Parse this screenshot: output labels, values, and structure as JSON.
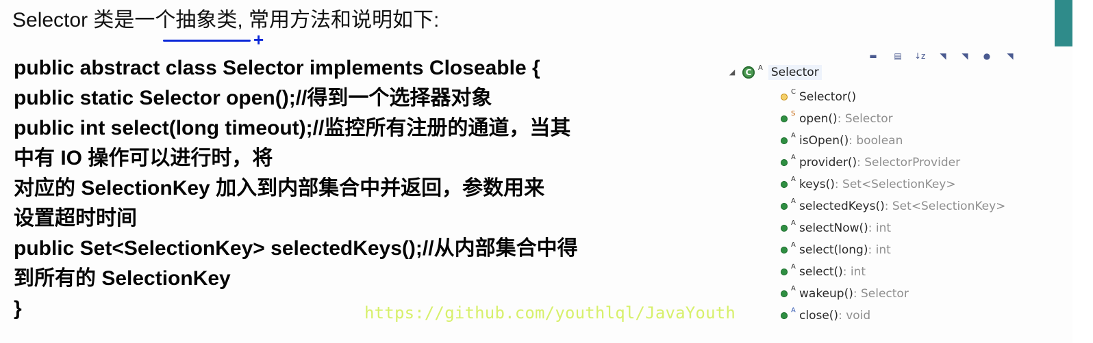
{
  "intro": {
    "text": "Selector 类是一个抽象类, 常用方法和说明如下:"
  },
  "code_lines": [
    "public abstract class Selector implements Closeable {",
    "public static Selector open();//得到一个选择器对象",
    "public int select(long timeout);//监控所有注册的通道，当其",
    "中有 IO 操作可以进行时，将",
    "对应的 SelectionKey 加入到内部集合中并返回，参数用来",
    "设置超时时间",
    "public Set<SelectionKey> selectedKeys();//从内部集合中得",
    "到所有的 SelectionKey",
    "}"
  ],
  "watermark": {
    "text": "https://github.com/youthlql/JavaYouth"
  },
  "outline": {
    "root": {
      "label": "Selector",
      "class_badge": "C",
      "modifier": "A",
      "expander": "◢"
    },
    "toolbar_icons": [
      "fields-icon",
      "static-icon",
      "sort-icon",
      "hide-fields-icon",
      "hide-static-icon",
      "hide-nonpublic-icon",
      "collapse-icon"
    ],
    "members": [
      {
        "kind": "ctor",
        "modifier": "C",
        "name": "Selector()",
        "type": ""
      },
      {
        "kind": "method",
        "modifier": "S",
        "name": "open()",
        "type": " : Selector"
      },
      {
        "kind": "method",
        "modifier": "A",
        "name": "isOpen()",
        "type": " : boolean"
      },
      {
        "kind": "method",
        "modifier": "A",
        "name": "provider()",
        "type": " : SelectorProvider"
      },
      {
        "kind": "method",
        "modifier": "A",
        "name": "keys()",
        "type": " : Set<SelectionKey>"
      },
      {
        "kind": "method",
        "modifier": "A",
        "name": "selectedKeys()",
        "type": " : Set<SelectionKey>"
      },
      {
        "kind": "method",
        "modifier": "A",
        "name": "selectNow()",
        "type": " : int"
      },
      {
        "kind": "method",
        "modifier": "A",
        "name": "select(long)",
        "type": " : int"
      },
      {
        "kind": "method",
        "modifier": "A",
        "name": "select()",
        "type": " : int"
      },
      {
        "kind": "method",
        "modifier": "A",
        "name": "wakeup()",
        "type": " : Selector"
      },
      {
        "kind": "close",
        "modifier": "A",
        "name": "close()",
        "type": " : void"
      }
    ]
  }
}
